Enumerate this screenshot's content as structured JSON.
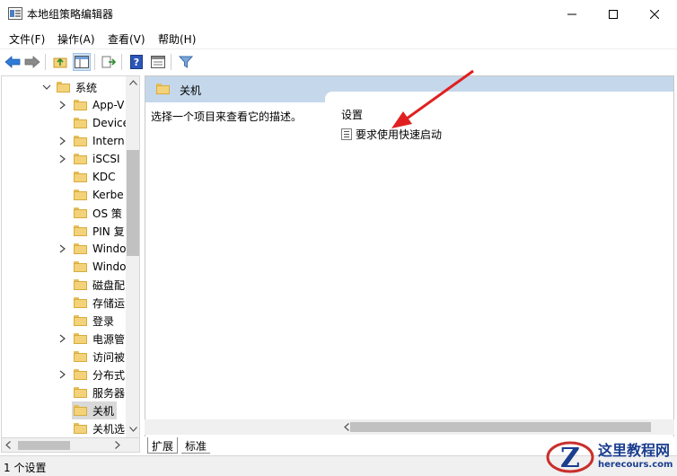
{
  "window": {
    "title": "本地组策略编辑器"
  },
  "menu": {
    "items": [
      "文件(F)",
      "操作(A)",
      "查看(V)",
      "帮助(H)"
    ]
  },
  "toolbar": {
    "buttons": [
      "back-icon",
      "forward-icon",
      "up-folder-icon",
      "show-hide-tree-icon",
      "export-list-icon",
      "help-icon",
      "properties-icon",
      "filter-icon"
    ]
  },
  "tree": {
    "root_label": "系统",
    "items": [
      {
        "label": "App-V",
        "expandable": true
      },
      {
        "label": "Device",
        "expandable": false
      },
      {
        "label": "Intern",
        "expandable": true
      },
      {
        "label": "iSCSI",
        "expandable": true
      },
      {
        "label": "KDC",
        "expandable": false
      },
      {
        "label": "Kerbe",
        "expandable": false
      },
      {
        "label": "OS 策",
        "expandable": false
      },
      {
        "label": "PIN 复",
        "expandable": false
      },
      {
        "label": "Windo",
        "expandable": true
      },
      {
        "label": "Windo",
        "expandable": false
      },
      {
        "label": "磁盘配",
        "expandable": false
      },
      {
        "label": "存储运",
        "expandable": false
      },
      {
        "label": "登录",
        "expandable": false
      },
      {
        "label": "电源管",
        "expandable": true
      },
      {
        "label": "访问被",
        "expandable": false
      },
      {
        "label": "分布式",
        "expandable": true
      },
      {
        "label": "服务器",
        "expandable": false
      },
      {
        "label": "关机",
        "expandable": false,
        "selected": true
      },
      {
        "label": "关机选",
        "expandable": false
      }
    ]
  },
  "detail": {
    "header_title": "关机",
    "description": "选择一个项目来查看它的描述。",
    "column_header": "设置",
    "settings": [
      "要求使用快速启动"
    ]
  },
  "bottom_tabs": [
    "扩展",
    "标准"
  ],
  "status": {
    "text": "1 个设置"
  },
  "watermark": {
    "title": "这里教程网",
    "url": "herecours.com"
  },
  "colors": {
    "header_band": "#c5d7ea",
    "arrow": "#e02020",
    "watermark": "#1a3d8f"
  }
}
